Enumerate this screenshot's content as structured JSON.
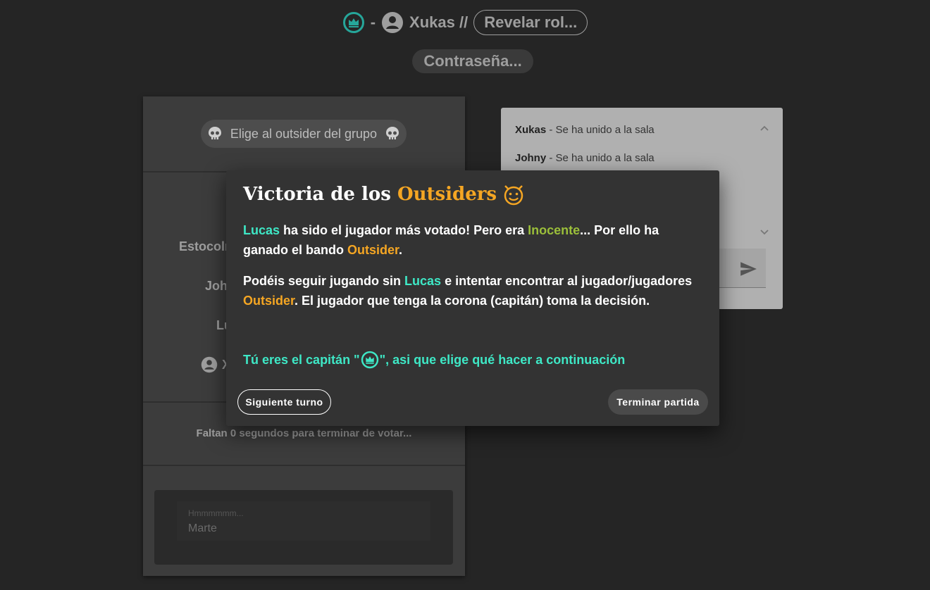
{
  "header": {
    "separator": "-",
    "username": "Xukas //",
    "reveal_label": "Revelar rol...",
    "password_label": "Contraseña..."
  },
  "left_card": {
    "chip_label": "Elige al outsider del grupo",
    "options": [
      "Estocolm",
      "Joh",
      "Lu",
      "X"
    ],
    "timer_text": "Faltan 0 segundos para terminar de votar...",
    "input": {
      "label": "Hmmmmmm...",
      "value": "Marte"
    }
  },
  "chat": {
    "messages": [
      {
        "user": "Xukas",
        "text": " - Se ha unido a la sala"
      },
      {
        "user": "Johny",
        "text": " - Se ha unido a la sala"
      }
    ]
  },
  "dialog": {
    "title_prefix": "Victoria de los ",
    "title_highlight": "Outsiders",
    "p1": {
      "player": "Lucas",
      "t1": " ha sido el jugador más votado! Pero era ",
      "role": "Inocente",
      "t2": "... Por ello ha ganado el bando ",
      "side": "Outsider",
      "t3": "."
    },
    "p2": {
      "t1": "Podéis seguir jugando sin ",
      "player": "Lucas",
      "t2": " e intentar encontrar al jugador/jugadores ",
      "side": "Outsider",
      "t3": ". El jugador que tenga la corona (capitán) toma la decisión."
    },
    "captain_pre": "Tú eres el capitán \"",
    "captain_post": "\", asi que elige qué hacer a continuación",
    "next_turn_label": "Siguiente turno",
    "end_game_label": "Terminar partida"
  },
  "colors": {
    "accent_cyan": "#3ee8c6",
    "outsider_orange": "#f5a623",
    "innocent_green": "#9bbf3a",
    "background": "#252525"
  },
  "icons": [
    "crown-icon",
    "user-icon",
    "skull-icon",
    "devil-icon",
    "send-icon",
    "chevron-up-icon",
    "chevron-down-icon"
  ]
}
